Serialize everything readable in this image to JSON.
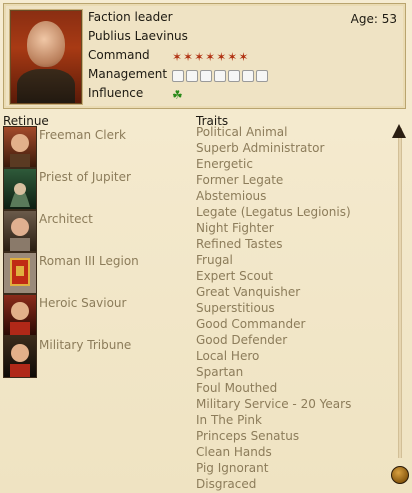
{
  "header": {
    "role": "Faction leader",
    "name": "Publius Laevinus",
    "age": "Age: 53",
    "command_label": "Command",
    "command_stars": 7,
    "management_label": "Management",
    "management_slots": 7,
    "influence_label": "Influence"
  },
  "retinue": {
    "title": "Retinue",
    "items": [
      {
        "label": "Freeman Clerk",
        "icon": "person-icon"
      },
      {
        "label": "Priest of Jupiter",
        "icon": "hooded-priest-icon"
      },
      {
        "label": "Architect",
        "icon": "person-icon"
      },
      {
        "label": "Roman III Legion",
        "icon": "standard-icon"
      },
      {
        "label": "Heroic Saviour",
        "icon": "person-icon"
      },
      {
        "label": "Military Tribune",
        "icon": "person-icon"
      }
    ]
  },
  "traits": {
    "title": "Traits",
    "items": [
      "Political Animal",
      "Superb Administrator",
      "Energetic",
      "Former Legate",
      "Abstemious",
      "Legate (Legatus Legionis)",
      "Night Fighter",
      "Refined Tastes",
      "Frugal",
      "Expert Scout",
      "Great Vanquisher",
      "Superstitious",
      "Good Commander",
      "Good Defender",
      "Local Hero",
      "Spartan",
      "Foul Mouthed",
      "Military Service - 20 Years",
      "In The Pink",
      "Princeps Senatus",
      "Clean Hands",
      "Pig Ignorant",
      "Disgraced"
    ]
  },
  "colors": {
    "muted_text": "#8c7c5a",
    "star_red": "#b03010",
    "influence_green": "#2a8a1a"
  }
}
